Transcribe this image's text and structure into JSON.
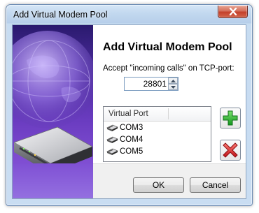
{
  "window": {
    "title": "Add Virtual Modem Pool"
  },
  "dialog": {
    "heading": "Add Virtual Modem Pool",
    "tcp_label": "Accept \"incoming calls\" on TCP-port:",
    "tcp_port": "28801"
  },
  "list": {
    "column_header": "Virtual Port",
    "items": [
      "COM3",
      "COM4",
      "COM5"
    ]
  },
  "buttons": {
    "ok": "OK",
    "cancel": "Cancel"
  },
  "icons": {
    "add": "plus-icon",
    "remove": "red-x-icon",
    "row": "modem-icon",
    "close": "close-icon"
  },
  "colors": {
    "banner": "#5a32b0",
    "add_icon": "#1fa82a",
    "remove_icon": "#d8242a",
    "close_button": "#c4402a"
  }
}
